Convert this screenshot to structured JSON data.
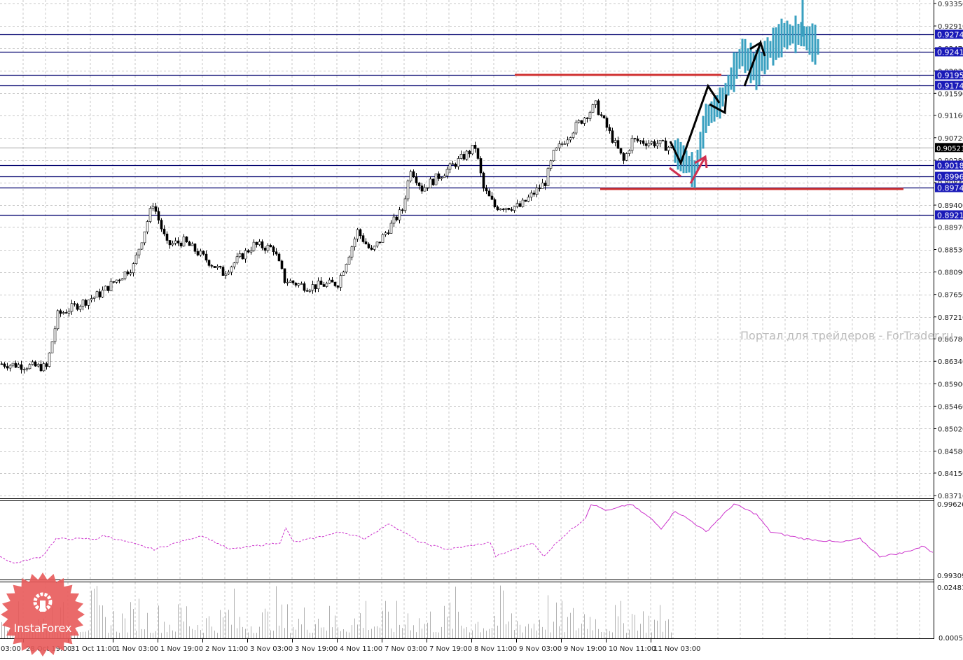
{
  "watermark": "Портал для трейдеров - ForTrader.ru",
  "logo": {
    "text": "InstaForex"
  },
  "colors": {
    "level_line": "#00006e",
    "level_label_bg": "#1a1ab8",
    "current_label_bg": "#000000",
    "forecast_bars": "#3aa0c0",
    "support_resistance": "#d03030",
    "indicator": "#cc33cc",
    "grid": "#c8c8c8",
    "volume": "#b0b0b0",
    "logo": "#e85a5a"
  },
  "price_axis": {
    "min": 0.8371,
    "max": 0.9335,
    "ticks": [
      "0.93350",
      "0.92910",
      "0.92470",
      "0.92030",
      "0.91590",
      "0.91160",
      "0.90720",
      "0.90280",
      "0.89840",
      "0.89400",
      "0.88970",
      "0.88530",
      "0.88090",
      "0.87650",
      "0.87210",
      "0.86780",
      "0.86340",
      "0.85900",
      "0.85460",
      "0.85020",
      "0.84580",
      "0.84150",
      "0.83710"
    ],
    "levels": [
      "0.9274",
      "0.9241",
      "0.9195",
      "0.9174",
      "0.9018",
      "0.8996",
      "0.8974",
      "0.8921"
    ],
    "current_price": "0.90521"
  },
  "time_axis": {
    "labels": [
      "03:00",
      "28 Oct 19:00",
      "31 Oct 11:00",
      "1 Nov 03:00",
      "1 Nov 19:00",
      "2 Nov 11:00",
      "3 Nov 03:00",
      "3 Nov 19:00",
      "4 Nov 11:00",
      "7 Nov 03:00",
      "7 Nov 19:00",
      "8 Nov 11:00",
      "9 Nov 03:00",
      "9 Nov 19:00",
      "10 Nov 11:00",
      "11 Nov 03:00"
    ]
  },
  "indicator_axis": {
    "max": "0.99626",
    "min": "0.99309"
  },
  "volume_axis": {
    "max": "0.02481",
    "min": "0.0005"
  },
  "chart_data": {
    "type": "candlestick",
    "bars_total": 240,
    "price_keypoints": [
      [
        0,
        0.8629
      ],
      [
        16,
        0.8622
      ],
      [
        20,
        0.8725
      ],
      [
        35,
        0.8766
      ],
      [
        47,
        0.8821
      ],
      [
        54,
        0.8944
      ],
      [
        59,
        0.8862
      ],
      [
        65,
        0.8869
      ],
      [
        79,
        0.8807
      ],
      [
        90,
        0.8862
      ],
      [
        97,
        0.8855
      ],
      [
        101,
        0.8793
      ],
      [
        109,
        0.878
      ],
      [
        120,
        0.8787
      ],
      [
        127,
        0.8889
      ],
      [
        132,
        0.8848
      ],
      [
        143,
        0.8931
      ],
      [
        146,
        0.9013
      ],
      [
        150,
        0.8972
      ],
      [
        160,
        0.9013
      ],
      [
        169,
        0.9054
      ],
      [
        172,
        0.8972
      ],
      [
        176,
        0.8937
      ],
      [
        185,
        0.8937
      ],
      [
        194,
        0.8985
      ],
      [
        197,
        0.904
      ],
      [
        205,
        0.9095
      ],
      [
        212,
        0.9136
      ],
      [
        217,
        0.9081
      ],
      [
        222,
        0.9026
      ],
      [
        225,
        0.9067
      ],
      [
        234,
        0.9061
      ],
      [
        239,
        0.9052
      ]
    ],
    "forecast_keypoints": [
      [
        241,
        0.9045
      ],
      [
        246,
        0.902
      ],
      [
        248,
        0.9
      ],
      [
        252,
        0.911
      ],
      [
        257,
        0.914
      ],
      [
        260,
        0.9175
      ],
      [
        265,
        0.9239
      ],
      [
        270,
        0.9205
      ],
      [
        275,
        0.9245
      ],
      [
        280,
        0.9273
      ],
      [
        286,
        0.9275
      ],
      [
        292,
        0.925
      ]
    ],
    "indicator_keypoints": [
      [
        0,
        0.99393
      ],
      [
        5,
        0.99362
      ],
      [
        15,
        0.99393
      ],
      [
        20,
        0.99471
      ],
      [
        35,
        0.99471
      ],
      [
        37,
        0.99486
      ],
      [
        55,
        0.99424
      ],
      [
        72,
        0.99486
      ],
      [
        82,
        0.99424
      ],
      [
        100,
        0.99455
      ],
      [
        102,
        0.99517
      ],
      [
        105,
        0.99455
      ],
      [
        122,
        0.99502
      ],
      [
        130,
        0.99471
      ],
      [
        139,
        0.99539
      ],
      [
        150,
        0.99455
      ],
      [
        160,
        0.99424
      ],
      [
        175,
        0.99455
      ],
      [
        177,
        0.99393
      ],
      [
        190,
        0.99455
      ],
      [
        194,
        0.99393
      ],
      [
        200,
        0.99471
      ],
      [
        209,
        0.99564
      ],
      [
        211,
        0.99626
      ],
      [
        217,
        0.99595
      ],
      [
        225,
        0.99626
      ],
      [
        232,
        0.99564
      ],
      [
        236,
        0.99517
      ],
      [
        241,
        0.99595
      ],
      [
        247,
        0.99548
      ],
      [
        252,
        0.99502
      ],
      [
        257,
        0.99564
      ],
      [
        262,
        0.99626
      ],
      [
        270,
        0.9958
      ],
      [
        275,
        0.99502
      ],
      [
        287,
        0.99471
      ],
      [
        300,
        0.99455
      ],
      [
        307,
        0.99471
      ],
      [
        314,
        0.99393
      ],
      [
        322,
        0.99408
      ],
      [
        330,
        0.99439
      ],
      [
        333,
        0.99408
      ]
    ],
    "indicator_dashed_until_bar": 209,
    "volume_range": [
      0.0005,
      0.02481
    ]
  }
}
